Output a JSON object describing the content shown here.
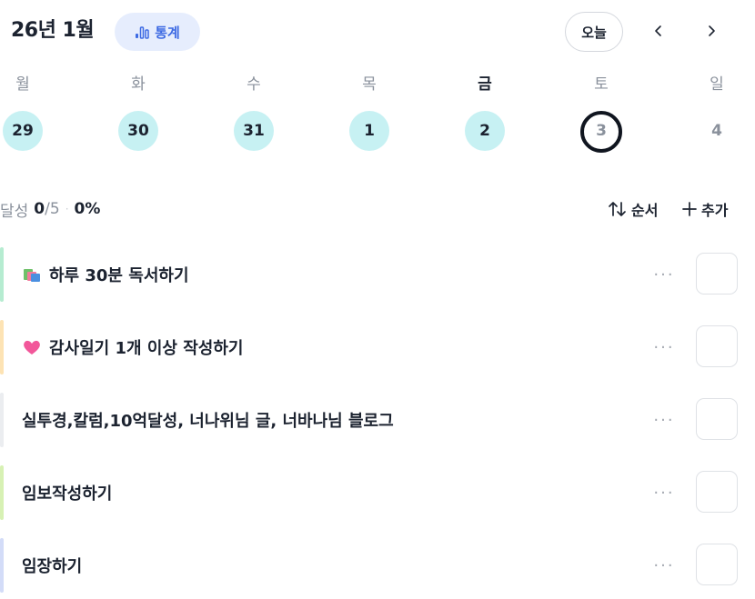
{
  "header": {
    "month_title": "26년 1월",
    "stats_label": "통계",
    "stats_icon": "bar-chart-icon",
    "today_label": "오늘",
    "prev_icon": "chevron-left-icon",
    "next_icon": "chevron-right-icon",
    "accent_color": "#3d6ae3"
  },
  "week": {
    "days": [
      {
        "name": "월",
        "date": "29",
        "state": "done"
      },
      {
        "name": "화",
        "date": "30",
        "state": "done"
      },
      {
        "name": "수",
        "date": "31",
        "state": "done"
      },
      {
        "name": "목",
        "date": "1",
        "state": "done"
      },
      {
        "name": "금",
        "date": "2",
        "state": "done"
      },
      {
        "name": "토",
        "date": "3",
        "state": "today"
      },
      {
        "name": "일",
        "date": "4",
        "state": "future"
      }
    ],
    "done_color": "#c7f1f3"
  },
  "progress": {
    "label": "달성",
    "done": "0",
    "slash": "/",
    "total": "5",
    "separator": "·",
    "percent": "0%"
  },
  "toolbar": {
    "order_label": "순서",
    "order_icon": "sort-icon",
    "add_label": "추가",
    "add_icon": "plus-icon"
  },
  "tasks": [
    {
      "title": "하루 30분 독서하기",
      "emoji": "books-icon",
      "bar_color": "#b6ecd1"
    },
    {
      "title": "감사일기 1개 이상 작성하기",
      "emoji": "heart-icon",
      "bar_color": "#fde3b4"
    },
    {
      "title": "실투경,칼럼,10억달성, 너나위님 글, 너바나님 블로그",
      "emoji": "",
      "bar_color": "#ebedf0"
    },
    {
      "title": "임보작성하기",
      "emoji": "",
      "bar_color": "#d7f1b4"
    },
    {
      "title": "임장하기",
      "emoji": "",
      "bar_color": "#d3dcf8"
    }
  ],
  "task_more_label": "···"
}
